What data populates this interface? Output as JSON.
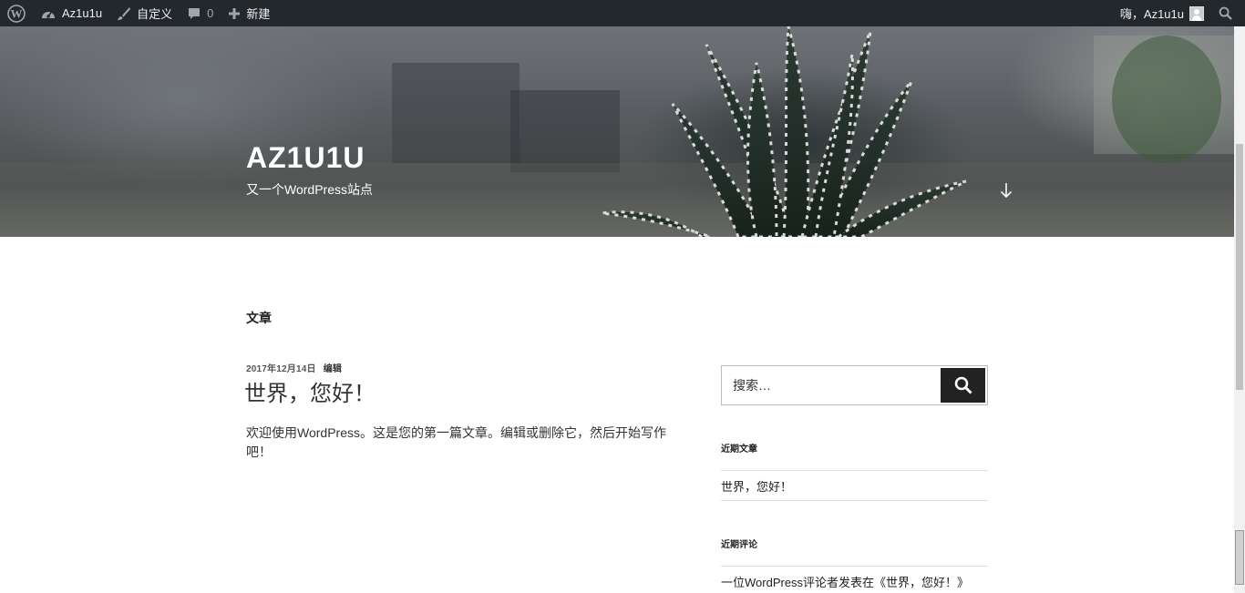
{
  "adminbar": {
    "site_name": "Az1u1u",
    "customize_label": "自定义",
    "comments_count": "0",
    "new_label": "新建",
    "greeting": "嗨，Az1u1u"
  },
  "header": {
    "site_title": "AZ1U1U",
    "site_description": "又一个WordPress站点"
  },
  "main": {
    "section_heading": "文章",
    "post": {
      "date": "2017年12月14日",
      "edit_label": "编辑",
      "title": "世界，您好！",
      "excerpt": "欢迎使用WordPress。这是您的第一篇文章。编辑或删除它，然后开始写作吧！"
    }
  },
  "sidebar": {
    "search": {
      "placeholder": "搜索…"
    },
    "recent_posts": {
      "title": "近期文章",
      "items": [
        "世界，您好！"
      ]
    },
    "recent_comments": {
      "title": "近期评论",
      "items": [
        "一位WordPress评论者发表在《世界，您好！》"
      ]
    }
  },
  "colors": {
    "adminbar_bg": "#23282d",
    "search_button_bg": "#222222"
  }
}
